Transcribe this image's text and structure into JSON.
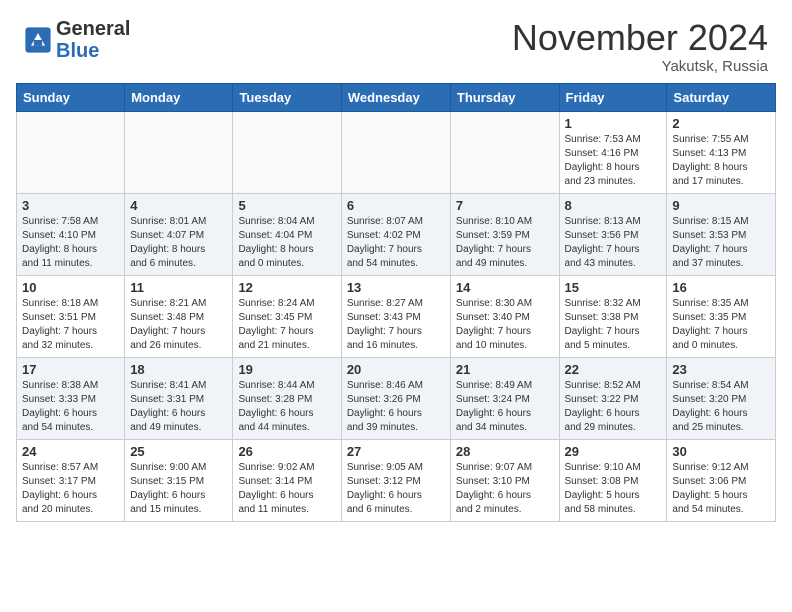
{
  "header": {
    "logo_general": "General",
    "logo_blue": "Blue",
    "month_title": "November 2024",
    "location": "Yakutsk, Russia"
  },
  "weekdays": [
    "Sunday",
    "Monday",
    "Tuesday",
    "Wednesday",
    "Thursday",
    "Friday",
    "Saturday"
  ],
  "weeks": [
    [
      {
        "day": "",
        "info": ""
      },
      {
        "day": "",
        "info": ""
      },
      {
        "day": "",
        "info": ""
      },
      {
        "day": "",
        "info": ""
      },
      {
        "day": "",
        "info": ""
      },
      {
        "day": "1",
        "info": "Sunrise: 7:53 AM\nSunset: 4:16 PM\nDaylight: 8 hours\nand 23 minutes."
      },
      {
        "day": "2",
        "info": "Sunrise: 7:55 AM\nSunset: 4:13 PM\nDaylight: 8 hours\nand 17 minutes."
      }
    ],
    [
      {
        "day": "3",
        "info": "Sunrise: 7:58 AM\nSunset: 4:10 PM\nDaylight: 8 hours\nand 11 minutes."
      },
      {
        "day": "4",
        "info": "Sunrise: 8:01 AM\nSunset: 4:07 PM\nDaylight: 8 hours\nand 6 minutes."
      },
      {
        "day": "5",
        "info": "Sunrise: 8:04 AM\nSunset: 4:04 PM\nDaylight: 8 hours\nand 0 minutes."
      },
      {
        "day": "6",
        "info": "Sunrise: 8:07 AM\nSunset: 4:02 PM\nDaylight: 7 hours\nand 54 minutes."
      },
      {
        "day": "7",
        "info": "Sunrise: 8:10 AM\nSunset: 3:59 PM\nDaylight: 7 hours\nand 49 minutes."
      },
      {
        "day": "8",
        "info": "Sunrise: 8:13 AM\nSunset: 3:56 PM\nDaylight: 7 hours\nand 43 minutes."
      },
      {
        "day": "9",
        "info": "Sunrise: 8:15 AM\nSunset: 3:53 PM\nDaylight: 7 hours\nand 37 minutes."
      }
    ],
    [
      {
        "day": "10",
        "info": "Sunrise: 8:18 AM\nSunset: 3:51 PM\nDaylight: 7 hours\nand 32 minutes."
      },
      {
        "day": "11",
        "info": "Sunrise: 8:21 AM\nSunset: 3:48 PM\nDaylight: 7 hours\nand 26 minutes."
      },
      {
        "day": "12",
        "info": "Sunrise: 8:24 AM\nSunset: 3:45 PM\nDaylight: 7 hours\nand 21 minutes."
      },
      {
        "day": "13",
        "info": "Sunrise: 8:27 AM\nSunset: 3:43 PM\nDaylight: 7 hours\nand 16 minutes."
      },
      {
        "day": "14",
        "info": "Sunrise: 8:30 AM\nSunset: 3:40 PM\nDaylight: 7 hours\nand 10 minutes."
      },
      {
        "day": "15",
        "info": "Sunrise: 8:32 AM\nSunset: 3:38 PM\nDaylight: 7 hours\nand 5 minutes."
      },
      {
        "day": "16",
        "info": "Sunrise: 8:35 AM\nSunset: 3:35 PM\nDaylight: 7 hours\nand 0 minutes."
      }
    ],
    [
      {
        "day": "17",
        "info": "Sunrise: 8:38 AM\nSunset: 3:33 PM\nDaylight: 6 hours\nand 54 minutes."
      },
      {
        "day": "18",
        "info": "Sunrise: 8:41 AM\nSunset: 3:31 PM\nDaylight: 6 hours\nand 49 minutes."
      },
      {
        "day": "19",
        "info": "Sunrise: 8:44 AM\nSunset: 3:28 PM\nDaylight: 6 hours\nand 44 minutes."
      },
      {
        "day": "20",
        "info": "Sunrise: 8:46 AM\nSunset: 3:26 PM\nDaylight: 6 hours\nand 39 minutes."
      },
      {
        "day": "21",
        "info": "Sunrise: 8:49 AM\nSunset: 3:24 PM\nDaylight: 6 hours\nand 34 minutes."
      },
      {
        "day": "22",
        "info": "Sunrise: 8:52 AM\nSunset: 3:22 PM\nDaylight: 6 hours\nand 29 minutes."
      },
      {
        "day": "23",
        "info": "Sunrise: 8:54 AM\nSunset: 3:20 PM\nDaylight: 6 hours\nand 25 minutes."
      }
    ],
    [
      {
        "day": "24",
        "info": "Sunrise: 8:57 AM\nSunset: 3:17 PM\nDaylight: 6 hours\nand 20 minutes."
      },
      {
        "day": "25",
        "info": "Sunrise: 9:00 AM\nSunset: 3:15 PM\nDaylight: 6 hours\nand 15 minutes."
      },
      {
        "day": "26",
        "info": "Sunrise: 9:02 AM\nSunset: 3:14 PM\nDaylight: 6 hours\nand 11 minutes."
      },
      {
        "day": "27",
        "info": "Sunrise: 9:05 AM\nSunset: 3:12 PM\nDaylight: 6 hours\nand 6 minutes."
      },
      {
        "day": "28",
        "info": "Sunrise: 9:07 AM\nSunset: 3:10 PM\nDaylight: 6 hours\nand 2 minutes."
      },
      {
        "day": "29",
        "info": "Sunrise: 9:10 AM\nSunset: 3:08 PM\nDaylight: 5 hours\nand 58 minutes."
      },
      {
        "day": "30",
        "info": "Sunrise: 9:12 AM\nSunset: 3:06 PM\nDaylight: 5 hours\nand 54 minutes."
      }
    ]
  ]
}
